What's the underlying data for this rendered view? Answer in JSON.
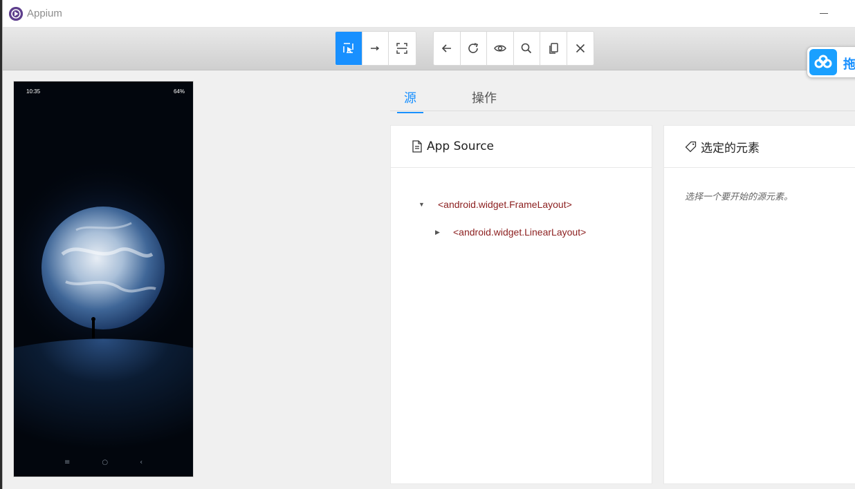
{
  "window": {
    "app_title": "Appium",
    "minimize_label": "—"
  },
  "toolbar": {
    "mode_group": [
      {
        "name": "select-elements",
        "icon": "select-cursor-icon",
        "active": true
      },
      {
        "name": "swipe-by-coordinates",
        "icon": "arrow-right-icon",
        "active": false
      },
      {
        "name": "tap-by-coordinates",
        "icon": "crop-frame-icon",
        "active": false
      }
    ],
    "action_group": [
      {
        "name": "back",
        "icon": "arrow-left-icon"
      },
      {
        "name": "refresh",
        "icon": "refresh-icon"
      },
      {
        "name": "toggle-visibility",
        "icon": "eye-icon"
      },
      {
        "name": "search",
        "icon": "search-icon"
      },
      {
        "name": "copy",
        "icon": "copy-icon"
      },
      {
        "name": "close",
        "icon": "close-icon"
      }
    ],
    "accent": "#1890ff"
  },
  "baidu_float": {
    "label": "拖"
  },
  "device": {
    "time": "10:35",
    "status_right": "64%",
    "nav_symbols": [
      "≡",
      "○",
      "‹"
    ]
  },
  "tabs": [
    {
      "label": "源",
      "active": true
    },
    {
      "label": "操作",
      "active": false
    }
  ],
  "source_panel": {
    "title": "App Source",
    "tree": [
      {
        "label": "<android.widget.FrameLayout>",
        "expanded": true,
        "depth": 0
      },
      {
        "label": "<android.widget.LinearLayout>",
        "expanded": false,
        "depth": 1
      }
    ]
  },
  "selected_panel": {
    "title": "选定的元素",
    "placeholder": "选择一个要开始的源元素。"
  }
}
